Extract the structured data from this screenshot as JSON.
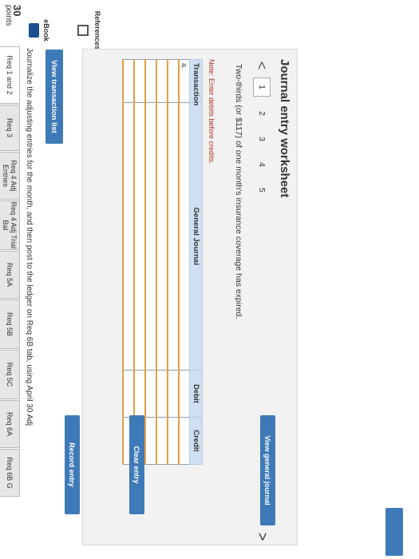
{
  "points": {
    "value": "30",
    "label": "points"
  },
  "side": {
    "ebook": "eBook",
    "references": "References"
  },
  "tabs": [
    {
      "label": "Req 1 and 2",
      "active": true
    },
    {
      "label": "Req 3",
      "active": false
    },
    {
      "label": "Req 4 Adj Entries",
      "active": false
    },
    {
      "label": "Req 4 Adj Trial Bal",
      "active": false
    },
    {
      "label": "Req 5A",
      "active": false
    },
    {
      "label": "Req 5B",
      "active": false
    },
    {
      "label": "Req 5C",
      "active": false
    },
    {
      "label": "Req 6A",
      "active": false
    },
    {
      "label": "Req 6B G",
      "active": false
    }
  ],
  "instructions": "Journalize the adjusting entries for the month, and then post to the ledger on Req 6B tab, using April 30 Adj",
  "view_transaction_list": "View transaction list",
  "worksheet": {
    "title": "Journal entry worksheet",
    "pages": [
      "1",
      "2",
      "3",
      "4",
      "5"
    ],
    "active_page": "1",
    "prev_glyph": "<",
    "next_glyph": ">",
    "description": "Two-thirds (or $117) of one month's insurance coverage has expired.",
    "note": "Note: Enter debits before credits.",
    "table": {
      "headers": [
        "Transaction",
        "General Journal",
        "Debit",
        "Credit"
      ],
      "rows": [
        [
          "a.",
          "",
          "",
          ""
        ],
        [
          "",
          "",
          "",
          ""
        ],
        [
          "",
          "",
          "",
          ""
        ],
        [
          "",
          "",
          "",
          ""
        ],
        [
          "",
          "",
          "",
          ""
        ],
        [
          "",
          "",
          "",
          ""
        ]
      ]
    },
    "buttons": {
      "record": "Record entry",
      "clear": "Clear entry",
      "view_general": "View general journal"
    }
  },
  "colors": {
    "accent": "#3f7ab8",
    "header_bg": "#cfe0f2",
    "note": "#b0301c"
  }
}
